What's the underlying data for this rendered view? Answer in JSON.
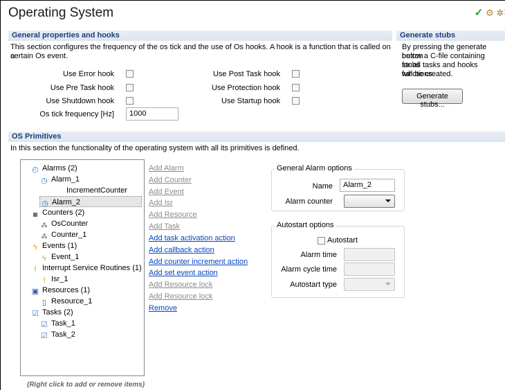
{
  "editor": {
    "title": "Operating System",
    "icons": [
      "checkmark-icon",
      "generate-icon",
      "hook-icon",
      "close-icon"
    ]
  },
  "general": {
    "header": "General properties and hooks",
    "description_line1": "This section configures the frequency of the os tick and the use of Os hooks. A hook is a function that is called on a",
    "description_line2": "certain Os event.",
    "hooks_left": [
      {
        "label": "Use Error hook",
        "checked": false
      },
      {
        "label": "Use Pre Task hook",
        "checked": false
      },
      {
        "label": "Use Shutdown hook",
        "checked": false
      }
    ],
    "hooks_right": [
      {
        "label": "Use Post Task hook",
        "checked": false
      },
      {
        "label": "Use Protection hook",
        "checked": false
      },
      {
        "label": "Use Startup hook",
        "checked": false
      }
    ],
    "tick_label": "Os tick frequency [Hz]",
    "tick_value": "1000"
  },
  "stubs": {
    "header": "Generate stubs",
    "line1": "By pressing the generate button",
    "line2": "below a C-file containing stubs",
    "line3": "for all tasks and hooks functions",
    "line4": "will be created.",
    "button": "Generate stubs..."
  },
  "primitives": {
    "header": "OS Primitives",
    "description": "In this section the functionality of the operating system with all its primitives is defined.",
    "tree": [
      {
        "label": "Alarms (2)",
        "icon": "alarm-group-icon",
        "level": 0
      },
      {
        "label": "Alarm_1",
        "icon": "alarm-icon",
        "level": 1
      },
      {
        "label": "IncrementCounter",
        "icon": "",
        "level": 2
      },
      {
        "label": "Alarm_2",
        "icon": "alarm-icon",
        "level": 1,
        "selected": true
      },
      {
        "label": "Counters (2)",
        "icon": "counter-group-icon",
        "level": 0
      },
      {
        "label": "OsCounter",
        "icon": "counter-icon",
        "level": 1
      },
      {
        "label": "Counter_1",
        "icon": "counter-icon",
        "level": 1
      },
      {
        "label": "Events (1)",
        "icon": "event-group-icon",
        "level": 0
      },
      {
        "label": "Event_1",
        "icon": "event-icon",
        "level": 1
      },
      {
        "label": "Interrupt Service Routines (1)",
        "icon": "isr-group-icon",
        "level": 0
      },
      {
        "label": "Isr_1",
        "icon": "isr-icon",
        "level": 1
      },
      {
        "label": "Resources (1)",
        "icon": "resource-group-icon",
        "level": 0
      },
      {
        "label": "Resource_1",
        "icon": "resource-icon",
        "level": 1
      },
      {
        "label": "Tasks (2)",
        "icon": "task-group-icon",
        "level": 0
      },
      {
        "label": "Task_1",
        "icon": "task-icon",
        "level": 1
      },
      {
        "label": "Task_2",
        "icon": "task-icon",
        "level": 1
      }
    ],
    "hint": "(Right click to add or remove items)",
    "actions": [
      {
        "label": "Add Alarm",
        "enabled": false
      },
      {
        "label": "Add Counter",
        "enabled": false
      },
      {
        "label": "Add Event",
        "enabled": false
      },
      {
        "label": "Add Isr",
        "enabled": false
      },
      {
        "label": "Add Resource",
        "enabled": false
      },
      {
        "label": "Add Task",
        "enabled": false
      },
      {
        "label": "Add task activation action",
        "enabled": true
      },
      {
        "label": "Add callback action",
        "enabled": true
      },
      {
        "label": "Add counter increment action",
        "enabled": true
      },
      {
        "label": "Add set event action",
        "enabled": true
      },
      {
        "label": "Add Resource lock",
        "enabled": false
      },
      {
        "label": "Add Resource lock",
        "enabled": false
      },
      {
        "label": "Remove",
        "enabled": true
      }
    ]
  },
  "alarm_options": {
    "title": "General Alarm options",
    "name_label": "Name",
    "name_value": "Alarm_2",
    "counter_label": "Alarm counter",
    "counter_value": ""
  },
  "autostart": {
    "title": "Autostart options",
    "checkbox_label": "Autostart",
    "checked": false,
    "time_label": "Alarm time",
    "cycle_label": "Alarm cycle time",
    "type_label": "Autostart type"
  }
}
